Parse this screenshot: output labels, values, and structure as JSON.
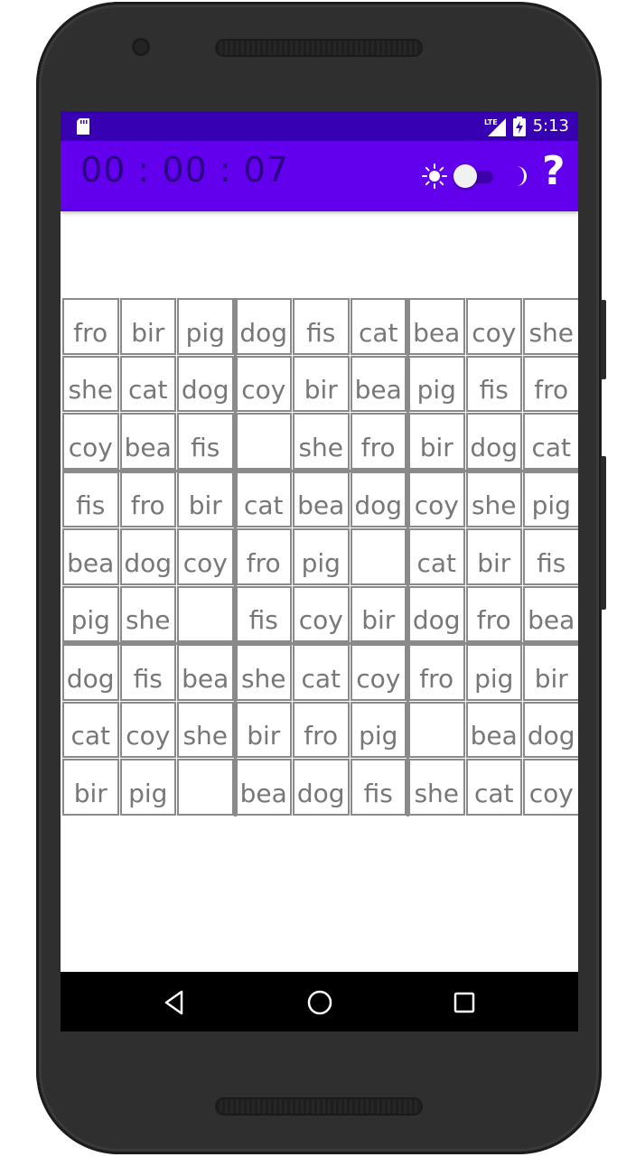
{
  "status_bar": {
    "time": "5:13",
    "network_label": "LTE",
    "icons": [
      "sd-card-icon",
      "signal-icon",
      "battery-charging-icon"
    ],
    "background": "#3700b3"
  },
  "app_bar": {
    "timer": "00 : 00 : 07",
    "theme_toggle_on": false,
    "help_label": "?",
    "background": "#6200ee",
    "icons": [
      "sun-icon",
      "theme-switch",
      "moon-icon",
      "help-icon"
    ]
  },
  "grid": {
    "rows": 9,
    "cols": 9,
    "cells": [
      [
        "fro",
        "bir",
        "pig",
        "dog",
        "fis",
        "cat",
        "bea",
        "coy",
        "she"
      ],
      [
        "she",
        "cat",
        "dog",
        "coy",
        "bir",
        "bea",
        "pig",
        "fis",
        "fro"
      ],
      [
        "coy",
        "bea",
        "fis",
        "",
        "she",
        "fro",
        "bir",
        "dog",
        "cat"
      ],
      [
        "fis",
        "fro",
        "bir",
        "cat",
        "bea",
        "dog",
        "coy",
        "she",
        "pig"
      ],
      [
        "bea",
        "dog",
        "coy",
        "fro",
        "pig",
        "",
        "cat",
        "bir",
        "fis"
      ],
      [
        "pig",
        "she",
        "",
        "fis",
        "coy",
        "bir",
        "dog",
        "fro",
        "bea"
      ],
      [
        "dog",
        "fis",
        "bea",
        "she",
        "cat",
        "coy",
        "fro",
        "pig",
        "bir"
      ],
      [
        "cat",
        "coy",
        "she",
        "bir",
        "fro",
        "pig",
        "",
        "bea",
        "dog"
      ],
      [
        "bir",
        "pig",
        "",
        "bea",
        "dog",
        "fis",
        "she",
        "cat",
        "coy"
      ]
    ]
  },
  "nav_bar": {
    "buttons": [
      "back-icon",
      "home-icon",
      "recents-icon"
    ]
  }
}
